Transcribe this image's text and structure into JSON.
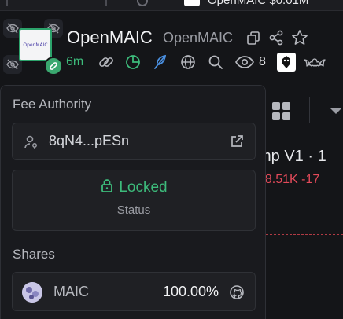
{
  "browser_tab": {
    "title": "OpenMAIC $0.01M"
  },
  "header": {
    "logo_text": "OpenMAIC",
    "token_name": "OpenMAIC",
    "token_symbol": "OpenMAIC",
    "age": "6m",
    "views": "8"
  },
  "background": {
    "pair_title": "mp V1 · 1",
    "pair_stats": "$8.51K  -17"
  },
  "popover": {
    "fee_authority": {
      "title": "Fee Authority",
      "address": "8qN4...pESn"
    },
    "lock": {
      "state": "Locked",
      "label": "Status"
    },
    "shares": {
      "title": "Shares",
      "items": [
        {
          "name": "MAIC",
          "percent": "100.00%"
        }
      ]
    }
  },
  "colors": {
    "accent_green": "#3dbb7b",
    "negative_red": "#e34a5a",
    "link_blue": "#4a8fe0",
    "panel_bg": "#191a1e"
  }
}
